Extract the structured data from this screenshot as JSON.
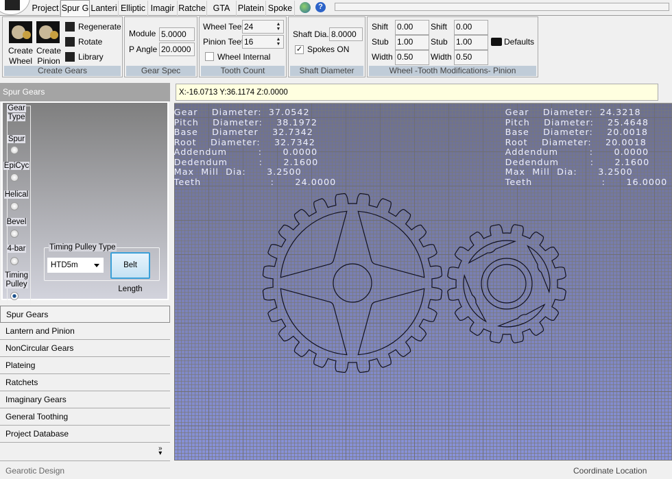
{
  "tabs": [
    "Project",
    "Spur G",
    "Lanteri",
    "Elliptic",
    "Imagir",
    "Ratche",
    "GTA",
    "Platein",
    "Spoke"
  ],
  "active_tab": "Spur G",
  "toolbar_icons": [
    "globe-link-icon",
    "help-icon"
  ],
  "ribbon": {
    "create_gears": {
      "caption": "Create Gears",
      "create_wheel": "Create\nWheel",
      "create_wheel_l1": "Create",
      "create_wheel_l2": "Wheel",
      "create_pinion_l1": "Create",
      "create_pinion_l2": "Pinion",
      "regenerate": "Regenerate",
      "rotate": "Rotate",
      "library": "Library"
    },
    "gear_spec": {
      "caption": "Gear Spec",
      "module_label": "Module",
      "module": "5.0000",
      "pangle_label": "P Angle",
      "pangle": "20.0000"
    },
    "tooth_count": {
      "caption": "Tooth Count",
      "wheel_teeth_label": "Wheel Teeth",
      "wheel_teeth": "24",
      "pinion_teeth_label": "Pinion Teeth",
      "pinion_teeth": "16",
      "wheel_internal_label": "Wheel Internal",
      "wheel_internal": false
    },
    "shaft": {
      "caption": "Shaft Diameter",
      "shaft_label": "Shaft Dia.",
      "shaft": "8.0000",
      "spokes_label": "Spokes ON",
      "spokes_on": true
    },
    "mods": {
      "caption": "Wheel -Tooth Modifications- Pinion",
      "shift_label": "Shift",
      "stub_label": "Stub",
      "width_label": "Width",
      "wheel_shift": "0.00",
      "wheel_stub": "1.00",
      "wheel_width": "0.50",
      "pinion_shift": "0.00",
      "pinion_stub": "1.00",
      "pinion_width": "0.50",
      "defaults": "Defaults"
    }
  },
  "left_panel": {
    "title": "Spur Gears",
    "gear_type_label_1": "Gear",
    "gear_type_label_2": "Type",
    "gear_types": [
      {
        "label": "Spur",
        "selected": false
      },
      {
        "label": "EpiCyc",
        "selected": false
      },
      {
        "label": "Helical",
        "selected": false
      },
      {
        "label": "Bevel",
        "selected": false
      },
      {
        "label": "4-bar",
        "selected": false
      },
      {
        "label": "Timing\nPulley",
        "l1": "Timing",
        "l2": "Pulley",
        "selected": true
      }
    ],
    "timing_pulley_label": "Timing Pulley Type",
    "timing_pulley_value": "HTD5m",
    "belt_length": "Belt Length"
  },
  "nav": [
    "Spur Gears",
    "Lantern and Pinion",
    "NonCircular Gears",
    "Plateing",
    "Ratchets",
    "Imaginary Gears",
    "General Toothing",
    "Project Database"
  ],
  "nav_selected": "Spur Gears",
  "coordinate": "X:-16.0713 Y:36.1174 Z:0.0000",
  "wheel_info": [
    "Gear    Diameter:  37.0542",
    "Pitch    Diameter:    38.1972",
    "Base    Diameter    32.7342",
    "Root    Diameter:    32.7342",
    "Addendum         :      0.0000",
    "Dedendum         :      2.1600",
    "Max  Mill  Dia:      3.2500",
    "Teeth                    :      24.0000"
  ],
  "pinion_info": [
    "Gear    Diameter:  24.3218",
    "Pitch    Diameter:    25.4648",
    "Base    Diameter:    20.0018",
    "Root    Diameter:    20.0018",
    "Addendum         :      0.0000",
    "Dedendum         :      2.1600",
    "Max  Mill  Dia:      3.2500",
    "Teeth                    :      16.0000"
  ],
  "gears": {
    "wheel_teeth": 24,
    "pinion_teeth": 16,
    "line_color": "#101020"
  },
  "status": {
    "left": "Gearotic Design",
    "right": "Coordinate Location"
  }
}
